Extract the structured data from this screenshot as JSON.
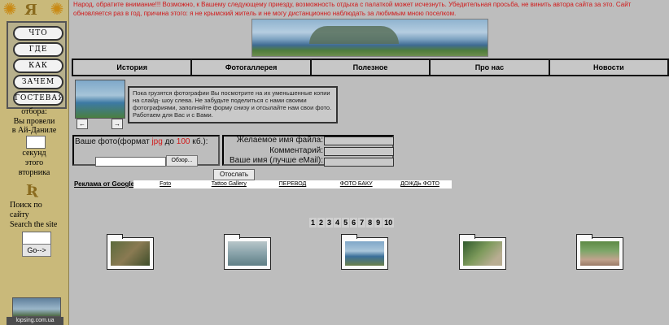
{
  "notice": "Народ, обратите внимание!!! Возможно, к Вашему следующему приезду, возможность отдыха с палаткой может исчезнуть. Убедительная просьба, не винить автора сайта за это. Сайт обновляется раз в год, причина этого: я не крымский житель и не могу дистанционно наблюдать за любимым мною поселком.",
  "sidebar": {
    "menu": [
      "ЧТО",
      "ГДЕ",
      "КАК",
      "ЗАЧЕМ",
      "ГОСТЕВАЯ"
    ],
    "otbora": "отбора:",
    "visited_1": "Вы провели",
    "visited_2": "в Ай-Даниле",
    "seconds": "секунд",
    "this_day": "этого",
    "day_name": "вторника",
    "search_ru_1": "Поиск по",
    "search_ru_2": "сайту",
    "search_en": "Search the site",
    "go": "Go-->",
    "site_link": "lopsing.com.ua"
  },
  "nav": [
    "История",
    "Фотогаллерея",
    "Полезное",
    "Про нас",
    "Новости"
  ],
  "slideshow": {
    "prev": "←",
    "next": "→"
  },
  "info_text": "Пока грузятся фотографии Вы посмотрите на их уменьшенные копии на слайд- шоу слева. Не забудьте поделиться с нами своими фотографиями, заполняйте форму снизу и отсылайте нам свои фото. Работаем для Вас и с Вами.",
  "upload": {
    "photo_label_a": "Ваше фото(формат ",
    "photo_fmt": "jpg",
    "photo_label_b": " до ",
    "photo_size": "100",
    "photo_label_c": " кб.):",
    "browse": "Обзор...",
    "filename_label": "Желаемое имя файла:",
    "comment_label": "Комментарий:",
    "name_label": "Ваше имя (лучше eMail):",
    "submit": "Отослать"
  },
  "ads": {
    "label": "Реклама от Google",
    "links": [
      "Foto",
      "Tattoo Gallery",
      "ПЕРЕВОД",
      "ФОТО БАКУ",
      "ДОЖДЬ ФОТО"
    ]
  },
  "pager": [
    "1",
    "2",
    "3",
    "4",
    "5",
    "6",
    "7",
    "8",
    "9",
    "10"
  ],
  "colors": {
    "notice": "#d11a1a",
    "sidebar": "#c9b97a",
    "page_bg": "#bdbdbd"
  }
}
